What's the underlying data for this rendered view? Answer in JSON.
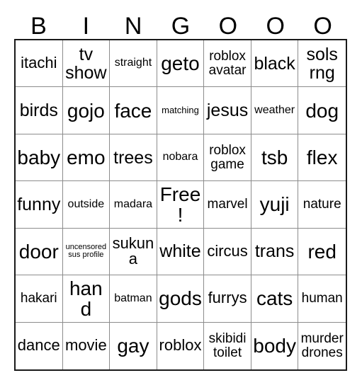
{
  "card": {
    "title": "BINGOOO",
    "columns": 7,
    "rows": 7,
    "header_letters": [
      "B",
      "I",
      "N",
      "G",
      "O",
      "O",
      "O"
    ],
    "border_color": "#1a1a1a",
    "gridline_color": "#8c8c8c",
    "background_color": "#ffffff",
    "text_color": "#000000",
    "free_space": "Free!",
    "cells": [
      [
        {
          "text": "itachi",
          "size": "l"
        },
        {
          "text": "tv show",
          "size": "xl"
        },
        {
          "text": "straight",
          "size": "s"
        },
        {
          "text": "geto",
          "size": "xxl"
        },
        {
          "text": "roblox avatar",
          "size": "m"
        },
        {
          "text": "black",
          "size": "xl"
        },
        {
          "text": "sols rng",
          "size": "xl"
        }
      ],
      [
        {
          "text": "birds",
          "size": "xl"
        },
        {
          "text": "gojo",
          "size": "xxl"
        },
        {
          "text": "face",
          "size": "xxl"
        },
        {
          "text": "matching",
          "size": "xs"
        },
        {
          "text": "jesus",
          "size": "xl"
        },
        {
          "text": "weather",
          "size": "s"
        },
        {
          "text": "dog",
          "size": "xxl"
        }
      ],
      [
        {
          "text": "baby",
          "size": "xxl"
        },
        {
          "text": "emo",
          "size": "xxl"
        },
        {
          "text": "trees",
          "size": "xl"
        },
        {
          "text": "nobara",
          "size": "s"
        },
        {
          "text": "roblox game",
          "size": "m"
        },
        {
          "text": "tsb",
          "size": "xxl"
        },
        {
          "text": "flex",
          "size": "xxl"
        }
      ],
      [
        {
          "text": "funny",
          "size": "xl"
        },
        {
          "text": "outside",
          "size": "s"
        },
        {
          "text": "madara",
          "size": "s"
        },
        {
          "text": "Free!",
          "size": "xxl"
        },
        {
          "text": "marvel",
          "size": "m"
        },
        {
          "text": "yuji",
          "size": "xxl"
        },
        {
          "text": "nature",
          "size": "m"
        }
      ],
      [
        {
          "text": "door",
          "size": "xxl"
        },
        {
          "text": "uncensored sus profile",
          "size": "xxs"
        },
        {
          "text": "sukuna",
          "size": "l"
        },
        {
          "text": "white",
          "size": "xl"
        },
        {
          "text": "circus",
          "size": "l"
        },
        {
          "text": "trans",
          "size": "xl"
        },
        {
          "text": "red",
          "size": "xxl"
        }
      ],
      [
        {
          "text": "hakari",
          "size": "m"
        },
        {
          "text": "hand",
          "size": "xxl"
        },
        {
          "text": "batman",
          "size": "s"
        },
        {
          "text": "gods",
          "size": "xxl"
        },
        {
          "text": "furrys",
          "size": "l"
        },
        {
          "text": "cats",
          "size": "xxl"
        },
        {
          "text": "human",
          "size": "m"
        }
      ],
      [
        {
          "text": "dance",
          "size": "l"
        },
        {
          "text": "movie",
          "size": "l"
        },
        {
          "text": "gay",
          "size": "xxl"
        },
        {
          "text": "roblox",
          "size": "l"
        },
        {
          "text": "skibidi toilet",
          "size": "m"
        },
        {
          "text": "body",
          "size": "xxl"
        },
        {
          "text": "murder drones",
          "size": "m"
        }
      ]
    ]
  }
}
